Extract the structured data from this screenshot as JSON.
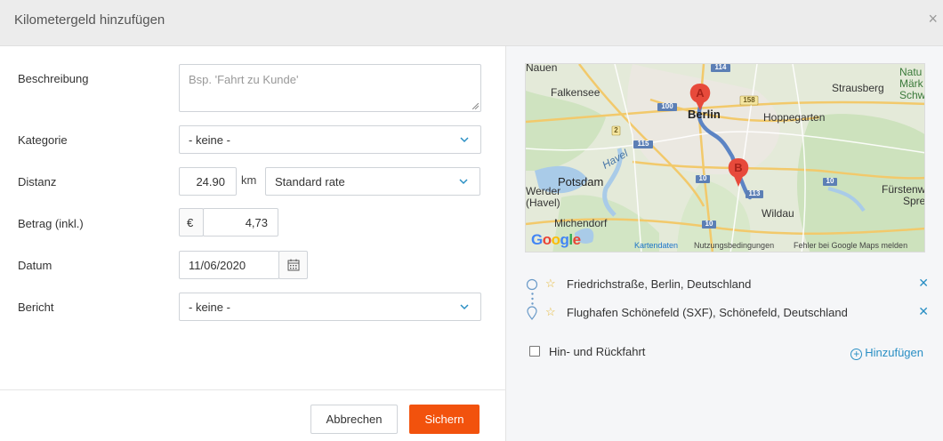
{
  "header": {
    "title": "Kilometergeld hinzufügen",
    "close_icon": "close-icon"
  },
  "form": {
    "description": {
      "label": "Beschreibung",
      "placeholder": "Bsp. 'Fahrt zu Kunde'"
    },
    "category": {
      "label": "Kategorie",
      "value": "- keine -"
    },
    "distance": {
      "label": "Distanz",
      "value": "24.90",
      "unit": "km",
      "rate": "Standard rate"
    },
    "amount": {
      "label": "Betrag (inkl.)",
      "currency": "€",
      "value": "4,73"
    },
    "date": {
      "label": "Datum",
      "value": "11/06/2020",
      "icon": "calendar-icon"
    },
    "report": {
      "label": "Bericht",
      "value": "- keine -"
    }
  },
  "footer": {
    "cancel_label": "Abbrechen",
    "save_label": "Sichern"
  },
  "map": {
    "places": {
      "nauen": "Nauen",
      "falkensee": "Falkensee",
      "berlin": "Berlin",
      "hoppegarten": "Hoppegarten",
      "strausberg": "Strausberg",
      "potsdam": "Potsdam",
      "michendorf": "Michendorf",
      "wildau": "Wildau",
      "werder": "Werder",
      "havel_town": "(Havel)",
      "havel_river": "Havel",
      "natur": "Natu",
      "maerk": "Märk",
      "schw": "Schw",
      "fuerstenw": "Fürstenw",
      "spre": "Spre"
    },
    "roads": {
      "r114": "114",
      "r100": "100",
      "r158": "158",
      "r2": "2",
      "r115": "115",
      "r10a": "10",
      "r10b": "10",
      "r10c": "10",
      "r113": "113",
      "r10d": "10"
    },
    "markers": {
      "start": "A",
      "end": "B"
    },
    "attribution": {
      "logo": "Google",
      "map_data": "Kartendaten",
      "terms": "Nutzungsbedingungen",
      "report": "Fehler bei Google Maps melden"
    }
  },
  "route": {
    "stops": [
      {
        "address": "Friedrichstraße, Berlin, Deutschland"
      },
      {
        "address": "Flughafen Schönefeld (SXF), Schönefeld, Deutschland"
      }
    ],
    "round_trip_label": "Hin- und Rückfahrt",
    "add_label": "Hinzufügen"
  },
  "colors": {
    "accent": "#f2520d",
    "link": "#2a8fc4",
    "header_bg": "#ececec",
    "panel_bg": "#f5f6f8"
  }
}
